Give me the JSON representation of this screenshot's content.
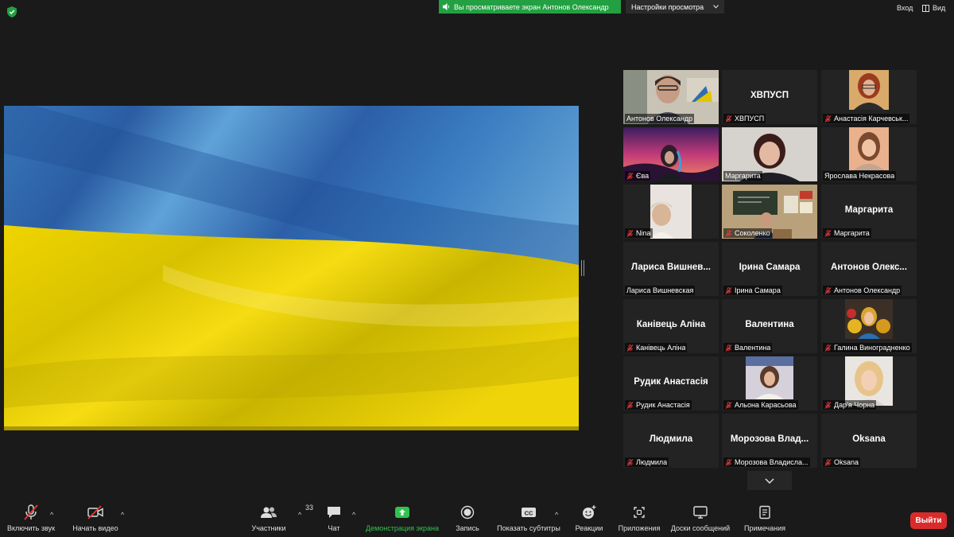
{
  "topbar": {
    "share_banner": "Вы просматриваете экран Антонов Олександр",
    "view_options": "Настройки просмотра",
    "enter_label": "Вход",
    "view_label": "Вид"
  },
  "participants": [
    {
      "big": "",
      "caption": "Антонов Олександр",
      "muted": false,
      "video": "man"
    },
    {
      "big": "ХВПУСП",
      "caption": "ХВПУСП",
      "muted": true,
      "video": ""
    },
    {
      "big": "",
      "caption": "Анастасія Карчевськ...",
      "muted": true,
      "video": "woman-red"
    },
    {
      "big": "",
      "caption": "Єва",
      "muted": true,
      "video": "sunset"
    },
    {
      "big": "",
      "caption": "Маргарита",
      "muted": false,
      "video": "woman-dark"
    },
    {
      "big": "",
      "caption": "Ярослава Некрасова",
      "muted": false,
      "video": "girl"
    },
    {
      "big": "",
      "caption": "Nina",
      "muted": true,
      "video": "nina"
    },
    {
      "big": "",
      "caption": "Соколенко",
      "muted": true,
      "video": "classroom"
    },
    {
      "big": "Маргарита",
      "caption": "Маргарита",
      "muted": true,
      "video": ""
    },
    {
      "big": "Лариса Вишнев...",
      "caption": "Лариса Вишневская",
      "muted": false,
      "video": ""
    },
    {
      "big": "Ірина Самара",
      "caption": "Ірина Самара",
      "muted": true,
      "video": ""
    },
    {
      "big": "Антонов Олекс...",
      "caption": "Антонов Олександр",
      "muted": true,
      "video": ""
    },
    {
      "big": "Канівець Аліна",
      "caption": "Канівець Аліна",
      "muted": true,
      "video": ""
    },
    {
      "big": "Валентина",
      "caption": "Валентина",
      "muted": true,
      "video": ""
    },
    {
      "big": "",
      "caption": "Галина Виноградненко",
      "muted": true,
      "video": "flowers"
    },
    {
      "big": "Рудик Анастасія",
      "caption": "Рудик Анастасія",
      "muted": true,
      "video": ""
    },
    {
      "big": "",
      "caption": "Альона Карасьова",
      "muted": true,
      "video": "lady"
    },
    {
      "big": "",
      "caption": "Дар'я Чорна",
      "muted": true,
      "video": "blonde"
    },
    {
      "big": "Людмила",
      "caption": "Людмила",
      "muted": true,
      "video": ""
    },
    {
      "big": "Морозова Влад...",
      "caption": "Морозова Владисла...",
      "muted": true,
      "video": ""
    },
    {
      "big": "Oksana",
      "caption": "Oksana",
      "muted": true,
      "video": ""
    }
  ],
  "toolbar": {
    "unmute": "Включить звук",
    "start_video": "Начать видео",
    "participants": "Участники",
    "participants_count": "33",
    "chat": "Чат",
    "share_screen": "Демонстрация экрана",
    "record": "Запись",
    "captions": "Показать субтитры",
    "reactions": "Реакции",
    "apps": "Приложения",
    "whiteboards": "Доски сообщений",
    "notes": "Примечания",
    "leave": "Выйти"
  },
  "colors": {
    "accent_green": "#23a042",
    "leave_red": "#d92b2b",
    "flag_blue": "#2f69b0",
    "flag_yellow": "#f2d500"
  },
  "icons": [
    "shield-icon",
    "speaker-icon",
    "chevron-down-icon",
    "grid-icon",
    "mic-off-icon",
    "video-off-icon",
    "participants-icon",
    "chat-icon",
    "share-icon",
    "record-icon",
    "cc-icon",
    "reactions-icon",
    "apps-icon",
    "whiteboard-icon",
    "notes-icon"
  ]
}
